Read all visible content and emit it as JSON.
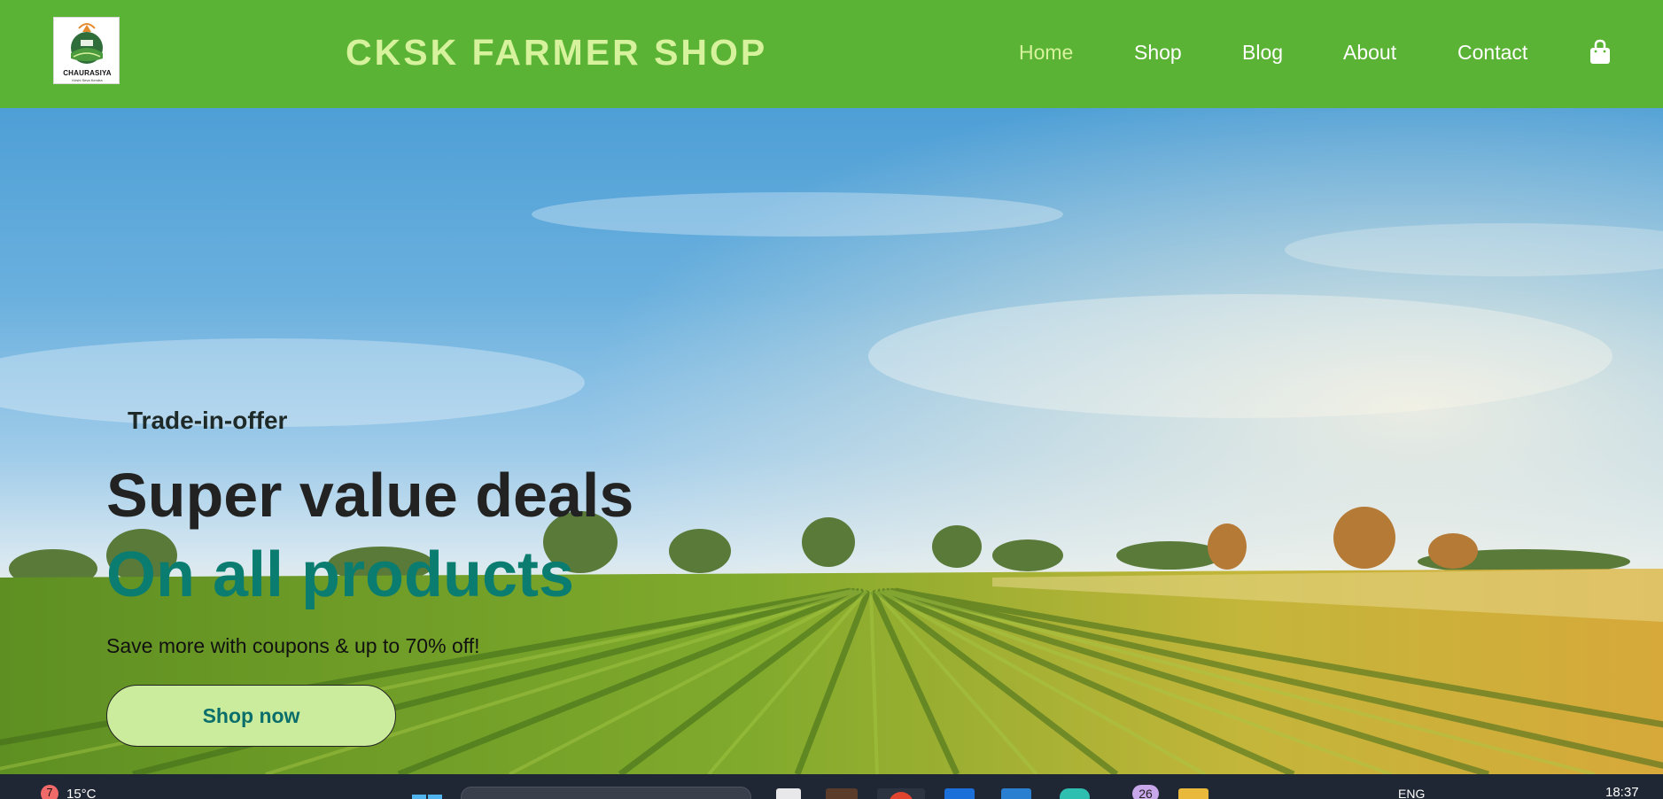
{
  "brand": {
    "logo_name": "CHAURASIYA",
    "logo_tagline": "Krishi Seva Kendra",
    "title": "CKSK FARMER SHOP"
  },
  "nav": {
    "items": [
      "Home",
      "Shop",
      "Blog",
      "About",
      "Contact"
    ],
    "active": "Home",
    "cart_icon": "shopping-bag-icon"
  },
  "hero": {
    "eyebrow": "Trade-in-offer",
    "headline": "Super value deals",
    "highlight": "On all products",
    "subtext": "Save more with coupons & up to 70% off!",
    "cta": "Shop now"
  },
  "taskbar": {
    "weather_badge": "7",
    "temperature": "15°C",
    "notification_count": "26",
    "language": "ENG",
    "time": "18:37"
  },
  "colors": {
    "header_bg": "#5ab334",
    "brand_text": "#d7f29c",
    "highlight_text": "#0a7d70",
    "cta_bg": "#cbeb9d",
    "taskbar_bg": "#202734"
  }
}
